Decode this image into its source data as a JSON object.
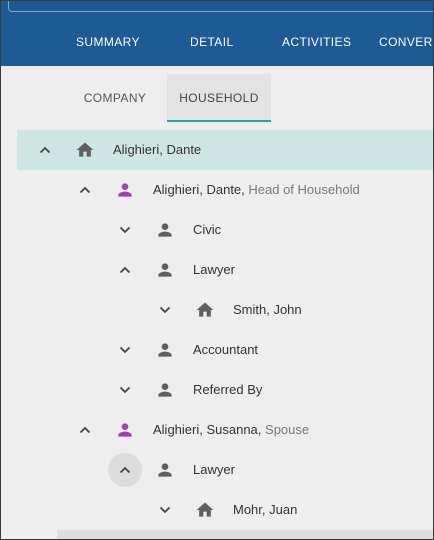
{
  "main_tabs": [
    "SUMMARY",
    "DETAIL",
    "ACTIVITIES",
    "CONVERS"
  ],
  "sub_tabs": [
    "COMPANY",
    "HOUSEHOLD"
  ],
  "active_sub_tab": "HOUSEHOLD",
  "colors": {
    "appbar": "#1e5a96",
    "accent": "#26a69a",
    "person_member": "#a63db8",
    "icon_gray": "#5f5f5f",
    "selected_row": "#cde6e3"
  },
  "tree": [
    {
      "label": "Alighieri, Dante",
      "role": "",
      "icon": "home-icon",
      "chevron": "chevron-up-icon",
      "selected": true
    },
    {
      "label": "Alighieri, Dante",
      "role": "Head of Household",
      "icon": "person-icon",
      "chevron": "chevron-up-icon"
    },
    {
      "label": "Civic",
      "role": "",
      "icon": "person-icon",
      "chevron": "chevron-down-icon"
    },
    {
      "label": "Lawyer",
      "role": "",
      "icon": "person-icon",
      "chevron": "chevron-up-icon"
    },
    {
      "label": "Smith, John",
      "role": "",
      "icon": "home-icon",
      "chevron": "chevron-down-icon"
    },
    {
      "label": "Accountant",
      "role": "",
      "icon": "person-icon",
      "chevron": "chevron-down-icon"
    },
    {
      "label": "Referred By",
      "role": "",
      "icon": "person-icon",
      "chevron": "chevron-down-icon"
    },
    {
      "label": "Alighieri, Susanna",
      "role": "Spouse",
      "icon": "person-icon",
      "chevron": "chevron-up-icon"
    },
    {
      "label": "Lawyer",
      "role": "",
      "icon": "person-icon",
      "chevron": "chevron-up-icon",
      "focused": true
    },
    {
      "label": "Mohr, Juan",
      "role": "",
      "icon": "home-icon",
      "chevron": "chevron-down-icon"
    }
  ]
}
